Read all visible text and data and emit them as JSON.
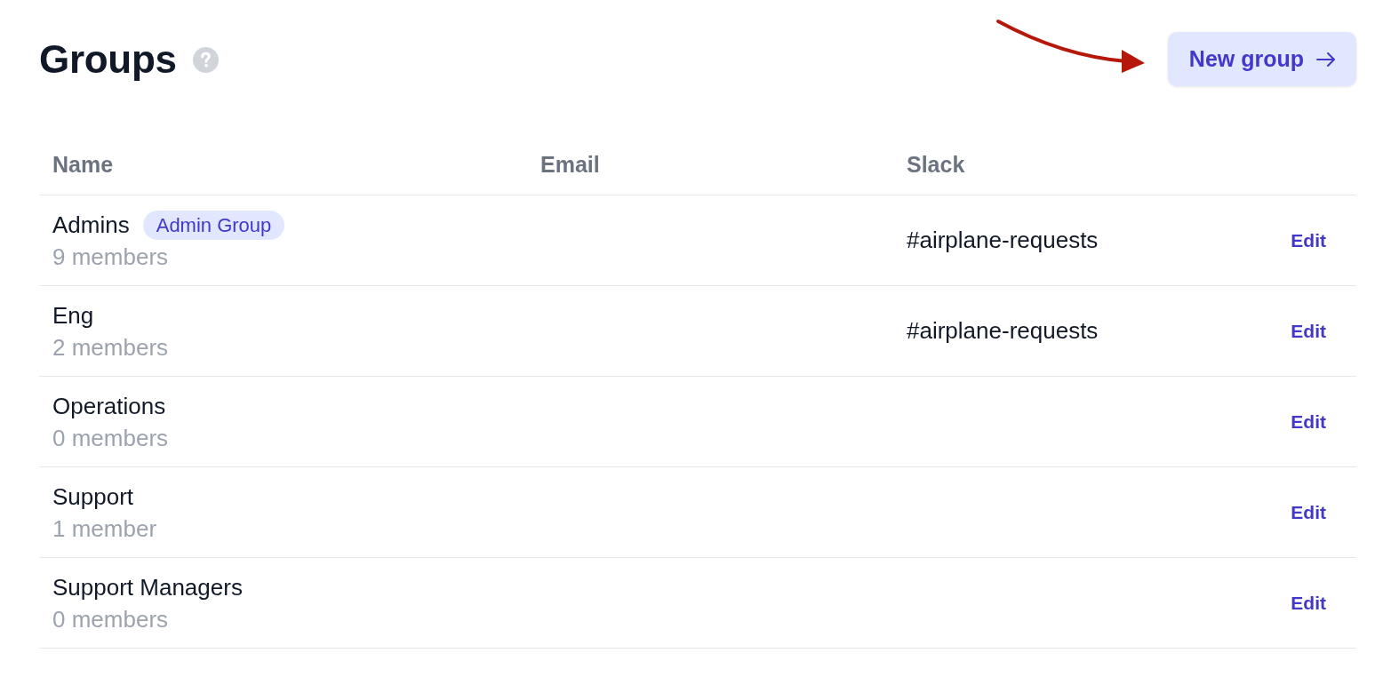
{
  "header": {
    "title": "Groups",
    "new_group_button": "New group"
  },
  "table": {
    "columns": [
      "Name",
      "Email",
      "Slack"
    ],
    "rows": [
      {
        "name": "Admins",
        "tag": "Admin Group",
        "members": "9 members",
        "slack": "#airplane-requests",
        "action": "Edit"
      },
      {
        "name": "Eng",
        "members": "2 members",
        "slack": "#airplane-requests",
        "action": "Edit"
      },
      {
        "name": "Operations",
        "members": "0 members",
        "action": "Edit"
      },
      {
        "name": "Support",
        "members": "1 member",
        "action": "Edit"
      },
      {
        "name": "Support Managers",
        "members": "0 members",
        "action": "Edit"
      }
    ]
  }
}
